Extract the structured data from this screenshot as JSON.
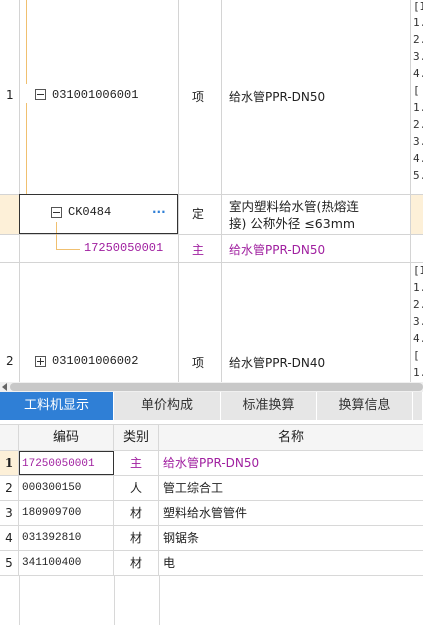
{
  "top_table": {
    "rows": [
      {
        "seq": "1",
        "code": "031001006001",
        "type": "项",
        "name": "给水管PPR-DN50",
        "expand": "minus"
      },
      {
        "seq": "",
        "code": "CK0484",
        "type": "定",
        "name_line1": "室内塑料给水管(热熔连",
        "name_line2": "接) 公称外径 ≤63mm",
        "ellipsis": "···",
        "expand": "minus"
      },
      {
        "seq": "",
        "code": "17250050001",
        "type": "主",
        "name": "给水管PPR-DN50"
      },
      {
        "seq": "2",
        "code": "031001006002",
        "type": "项",
        "name": "给水管PPR-DN40",
        "expand": "plus"
      }
    ],
    "desc_row1": [
      "[I",
      "1.",
      "2.",
      "3.",
      "4.",
      "[",
      "1.",
      "2.",
      "3.",
      "4.",
      "5."
    ],
    "desc_row4": [
      "[I",
      "1.",
      "2.",
      "3.",
      "4.",
      "[",
      "1."
    ]
  },
  "tabs": [
    {
      "label": "工料机显示",
      "active": true
    },
    {
      "label": "单价构成",
      "active": false
    },
    {
      "label": "标准换算",
      "active": false
    },
    {
      "label": "换算信息",
      "active": false
    }
  ],
  "bottom_table": {
    "headers": [
      "编码",
      "类别",
      "名称"
    ],
    "rows": [
      {
        "seq": "1",
        "code": "17250050001",
        "cat": "主",
        "name": "给水管PPR-DN50",
        "highlight": true
      },
      {
        "seq": "2",
        "code": "000300150",
        "cat": "人",
        "name": "管工综合工"
      },
      {
        "seq": "3",
        "code": "180909700",
        "cat": "材",
        "name": "塑料给水管管件"
      },
      {
        "seq": "4",
        "code": "031392810",
        "cat": "材",
        "name": "钢锯条"
      },
      {
        "seq": "5",
        "code": "341100400",
        "cat": "材",
        "name": "电"
      }
    ]
  },
  "colors": {
    "accent": "#2f7fd6",
    "main_material": "#a020a0",
    "tree_line": "#f0c070",
    "selected_row": "#fdf0d8"
  }
}
